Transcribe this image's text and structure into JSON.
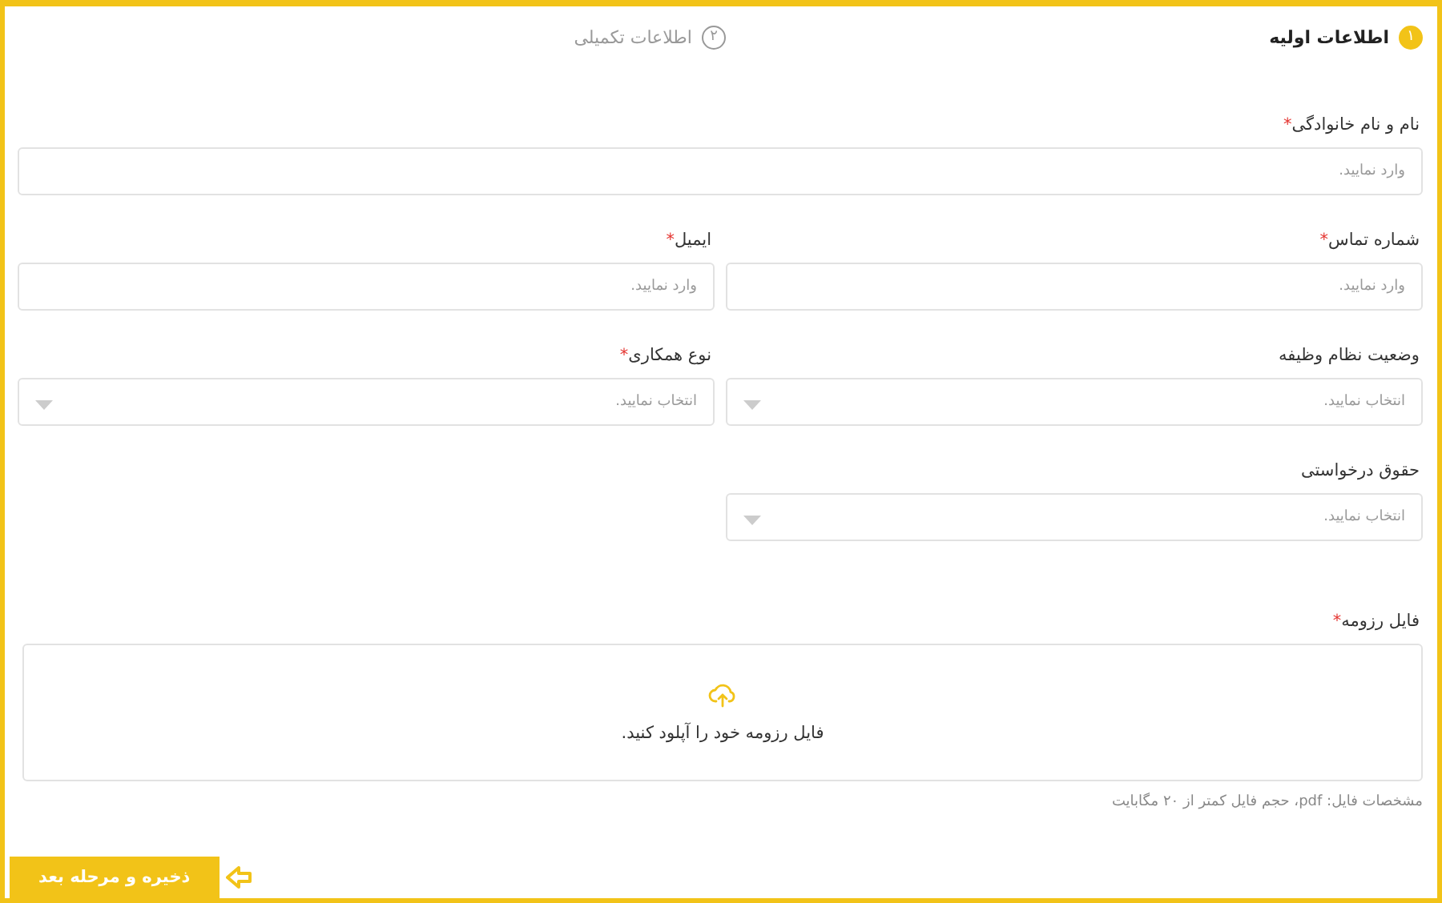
{
  "steps": [
    {
      "number": "۱",
      "label": "اطلاعات اولیه",
      "selected": true
    },
    {
      "number": "۲",
      "label": "اطلاعات تکمیلی",
      "selected": false
    }
  ],
  "rows": [
    {
      "fields": [
        {
          "kind": "text",
          "label": "نام و نام خانوادگی",
          "required_mark": "*",
          "placeholder": "وارد نمایید."
        }
      ]
    },
    {
      "fields": [
        {
          "kind": "text",
          "label": "شماره تماس",
          "required_mark": "*",
          "placeholder": "وارد نمایید."
        },
        {
          "kind": "text",
          "label": "ایمیل",
          "required_mark": "*",
          "placeholder": "وارد نمایید."
        }
      ]
    },
    {
      "fields": [
        {
          "kind": "select",
          "label": "وضعیت نظام وظیفه",
          "placeholder": "انتخاب نمایید."
        },
        {
          "kind": "select",
          "label": "نوع همکاری",
          "required_mark": "*",
          "placeholder": "انتخاب نمایید."
        }
      ]
    },
    {
      "fields": [
        {
          "kind": "select",
          "label": "حقوق درخواستی",
          "placeholder": "انتخاب نمایید."
        }
      ]
    }
  ],
  "upload": {
    "label": "فایل رزومه",
    "required_mark": "*",
    "prompt": "فایل رزومه خود را آپلود کنید.",
    "note": "مشخصات فایل: pdf، حجم فایل کمتر از ۲۰ مگابایت"
  },
  "submit": {
    "label": "ذخیره و مرحله بعد"
  }
}
